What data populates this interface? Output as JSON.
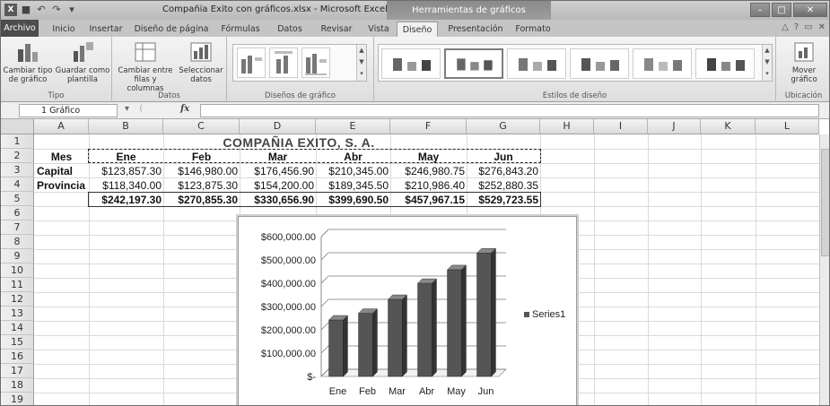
{
  "titlebar": {
    "title": "Compañia Exito con gráficos.xlsx - Microsoft Excel",
    "context_tab": "Herramientas de gráficos"
  },
  "tabs": [
    "Archivo",
    "Inicio",
    "Insertar",
    "Diseño de página",
    "Fórmulas",
    "Datos",
    "Revisar",
    "Vista",
    "Diseño",
    "Presentación",
    "Formato"
  ],
  "ribbon": {
    "tipo": {
      "btn1": "Cambiar tipo de gráfico",
      "btn2": "Guardar como plantilla",
      "label": "Tipo"
    },
    "datos": {
      "btn1": "Cambiar entre filas y columnas",
      "btn2": "Seleccionar datos",
      "label": "Datos"
    },
    "disenos_label": "Diseños de gráfico",
    "estilos_label": "Estilos de diseño",
    "ubicacion": {
      "btn": "Mover gráfico",
      "label": "Ubicación"
    }
  },
  "formulabar": {
    "namebox": "1 Gráfico",
    "fx": "fx"
  },
  "sheet": {
    "columns": [
      "A",
      "B",
      "C",
      "D",
      "E",
      "F",
      "G",
      "H",
      "I",
      "J",
      "K",
      "L"
    ],
    "rows": [
      "1",
      "2",
      "3",
      "4",
      "5",
      "6",
      "7",
      "8",
      "9",
      "10",
      "11",
      "12",
      "13",
      "14",
      "15",
      "16",
      "17",
      "18",
      "19"
    ],
    "title": "COMPAÑIA EXITO, S. A.",
    "header": [
      "Mes",
      "Ene",
      "Feb",
      "Mar",
      "Abr",
      "May",
      "Jun"
    ],
    "capital": [
      "Capital",
      "$123,857.30",
      "$146,980.00",
      "$176,456.90",
      "$210,345.00",
      "$246,980.75",
      "$276,843.20"
    ],
    "provincia": [
      "Provincia",
      "$118,340.00",
      "$123,875.30",
      "$154,200.00",
      "$189,345.50",
      "$210,986.40",
      "$252,880.35"
    ],
    "totals": [
      "$242,197.30",
      "$270,855.30",
      "$330,656.90",
      "$399,690.50",
      "$457,967.15",
      "$529,723.55"
    ]
  },
  "chart_data": {
    "type": "bar",
    "categories": [
      "Ene",
      "Feb",
      "Mar",
      "Abr",
      "May",
      "Jun"
    ],
    "series": [
      {
        "name": "Series1",
        "values": [
          242197.3,
          270855.3,
          330656.9,
          399690.5,
          457967.15,
          529723.55
        ]
      }
    ],
    "yticks": [
      "$-",
      "$100,000.00",
      "$200,000.00",
      "$300,000.00",
      "$400,000.00",
      "$500,000.00",
      "$600,000.00"
    ],
    "ylim": [
      0,
      600000
    ],
    "grid": true,
    "legend": "right",
    "bar_color": "#555555"
  }
}
